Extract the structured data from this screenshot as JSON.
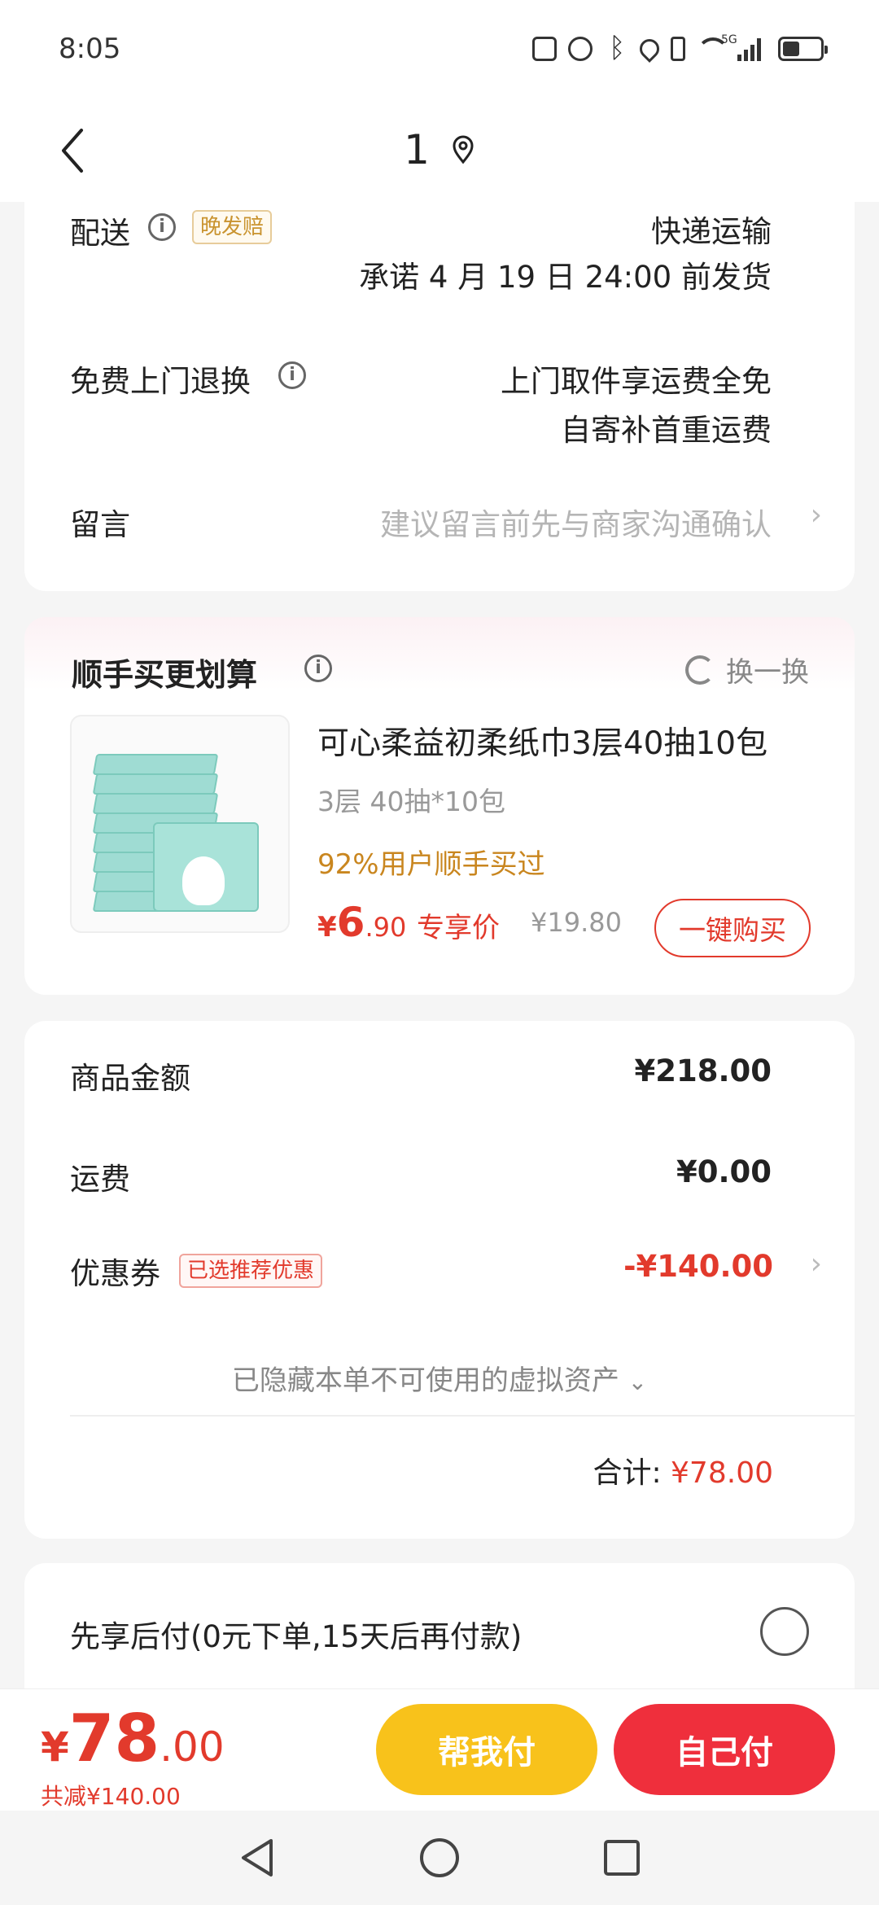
{
  "status_bar": {
    "time": "8:05",
    "network_label": "5G",
    "icons": [
      "nfc-icon",
      "alarm-icon",
      "bluetooth-icon",
      "location-icon",
      "vibrate-icon",
      "wifi-icon",
      "signal-icon",
      "battery-icon"
    ]
  },
  "header": {
    "title": "1",
    "icon": "location-pin-icon"
  },
  "shipping": {
    "label": "配送",
    "tag": "晚发赔",
    "method": "快递运输",
    "promise": "承诺 4 月 19 日 24:00 前发货"
  },
  "returns": {
    "label": "免费上门退换",
    "line1": "上门取件享运费全免",
    "line2": "自寄补首重运费"
  },
  "message": {
    "label": "留言",
    "placeholder": "建议留言前先与商家沟通确认"
  },
  "addon": {
    "title": "顺手买更划算",
    "swap_label": "换一换",
    "product": {
      "name": "可心柔益初柔纸巾3层40抽10包",
      "spec": "3层 40抽*10包",
      "popularity": "92%用户顺手买过",
      "price_currency": "¥",
      "price_int": "6",
      "price_dec": ".90",
      "price_label": "专享价",
      "original_price": "¥19.80",
      "buy_label": "一键购买"
    }
  },
  "summary": {
    "goods_label": "商品金额",
    "goods_value": "¥218.00",
    "shipping_label": "运费",
    "shipping_value": "¥0.00",
    "coupon_label": "优惠券",
    "coupon_tag": "已选推荐优惠",
    "coupon_value": "-¥140.00",
    "hidden_assets": "已隐藏本单不可使用的虚拟资产",
    "total_label": "合计:",
    "total_value": "¥78.00"
  },
  "pay_later": {
    "label": "先享后付(0元下单,15天后再付款)"
  },
  "bottom_bar": {
    "currency": "¥",
    "price_int": "78",
    "price_dec": ".00",
    "saved": "共减¥140.00",
    "help_pay_label": "帮我付",
    "self_pay_label": "自己付"
  },
  "colors": {
    "accent_red": "#e23a2c",
    "help_yellow": "#f8c21b",
    "self_red": "#ef2f3c",
    "popularity_orange": "#c9861f"
  }
}
